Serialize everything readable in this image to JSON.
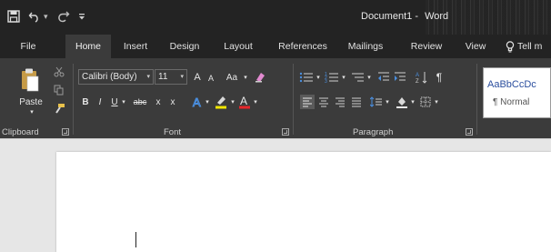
{
  "window": {
    "document_name": "Document1",
    "separator": "-",
    "app_name": "Word"
  },
  "qat": {
    "save_icon": "save-icon",
    "undo_icon": "undo-icon",
    "redo_icon": "redo-icon",
    "customize_icon": "customize-qat-icon"
  },
  "tabs": [
    {
      "label": "File"
    },
    {
      "label": "Home"
    },
    {
      "label": "Insert"
    },
    {
      "label": "Design"
    },
    {
      "label": "Layout"
    },
    {
      "label": "References"
    },
    {
      "label": "Mailings"
    },
    {
      "label": "Review"
    },
    {
      "label": "View"
    }
  ],
  "tellme": {
    "label": "Tell m"
  },
  "ribbon": {
    "clipboard": {
      "paste_label": "Paste",
      "group_label": "Clipboard"
    },
    "font": {
      "font_name": "Calibri (Body)",
      "font_size": "11",
      "grow_label": "A",
      "shrink_label": "A",
      "case_label": "Aa",
      "bold": "B",
      "italic": "I",
      "underline": "U",
      "strike": "abc",
      "subscript": "x",
      "superscript": "x",
      "font_color_label": "A",
      "group_label": "Font",
      "highlight_color": "#f2e600",
      "font_color": "#e8262a"
    },
    "paragraph": {
      "group_label": "Paragraph"
    },
    "styles": {
      "sample": "AaBbCcDc",
      "normal_label": "¶ Normal"
    }
  },
  "colors": {
    "titlebar": "#232323",
    "ribbon": "#3b3b3b",
    "document_bg": "#e6e6e6",
    "page": "#ffffff",
    "accent_blue": "#4a8fe0"
  }
}
